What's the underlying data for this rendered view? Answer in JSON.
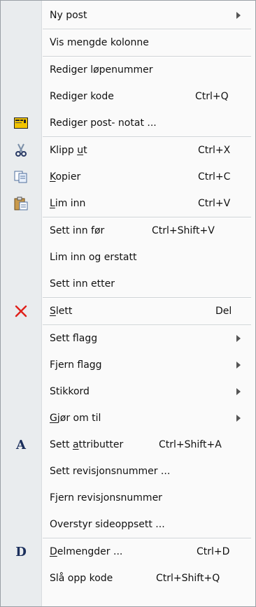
{
  "menu": {
    "items": [
      {
        "label": "Ny post",
        "shortcut": "",
        "submenu": true,
        "icon": ""
      },
      {
        "separator": true
      },
      {
        "label": "Vis mengde kolonne",
        "shortcut": "",
        "submenu": false,
        "icon": ""
      },
      {
        "separator": true
      },
      {
        "label": "Rediger løpenummer",
        "shortcut": "",
        "submenu": false,
        "icon": ""
      },
      {
        "label": "Rediger kode",
        "shortcut": "Ctrl+Q",
        "submenu": false,
        "icon": ""
      },
      {
        "label": "Rediger post- notat ...",
        "shortcut": "",
        "submenu": false,
        "icon": "note-icon"
      },
      {
        "separator": true
      },
      {
        "label": "Klipp ut",
        "shortcut": "Ctrl+X",
        "submenu": false,
        "icon": "scissors-icon"
      },
      {
        "label": "Kopier",
        "shortcut": "Ctrl+C",
        "submenu": false,
        "icon": "copy-icon"
      },
      {
        "label": "Lim inn",
        "shortcut": "Ctrl+V",
        "submenu": false,
        "icon": "paste-icon"
      },
      {
        "separator": true
      },
      {
        "label": "Sett inn før",
        "shortcut": "Ctrl+Shift+V",
        "submenu": false,
        "icon": ""
      },
      {
        "label": "Lim inn og erstatt",
        "shortcut": "",
        "submenu": false,
        "icon": ""
      },
      {
        "label": "Sett inn etter",
        "shortcut": "",
        "submenu": false,
        "icon": ""
      },
      {
        "separator": true
      },
      {
        "label": "Slett",
        "shortcut": "Del",
        "submenu": false,
        "icon": "delete-x-icon"
      },
      {
        "separator": true
      },
      {
        "label": "Sett flagg",
        "shortcut": "",
        "submenu": true,
        "icon": ""
      },
      {
        "label": "Fjern flagg",
        "shortcut": "",
        "submenu": true,
        "icon": ""
      },
      {
        "label": "Stikkord",
        "shortcut": "",
        "submenu": true,
        "icon": ""
      },
      {
        "label": "Gjør om til",
        "shortcut": "",
        "submenu": true,
        "icon": ""
      },
      {
        "label": "Sett attributter",
        "shortcut": "Ctrl+Shift+A",
        "submenu": false,
        "icon": "letter-a-icon"
      },
      {
        "label": "Sett revisjonsnummer ...",
        "shortcut": "",
        "submenu": false,
        "icon": ""
      },
      {
        "label": "Fjern revisjonsnummer",
        "shortcut": "",
        "submenu": false,
        "icon": ""
      },
      {
        "label": "Overstyr sideoppsett ...",
        "shortcut": "",
        "submenu": false,
        "icon": ""
      },
      {
        "separator": true
      },
      {
        "label": "Delmengder ...",
        "shortcut": "Ctrl+D",
        "submenu": false,
        "icon": "letter-d-icon"
      },
      {
        "label": "Slå opp kode",
        "shortcut": "Ctrl+Shift+Q",
        "submenu": false,
        "icon": ""
      }
    ]
  },
  "icon_text": {
    "A": "A",
    "D": "D"
  },
  "colors": {
    "delete": "#e0201a",
    "note": "#f2c400",
    "gutter": "#e9ecee"
  }
}
